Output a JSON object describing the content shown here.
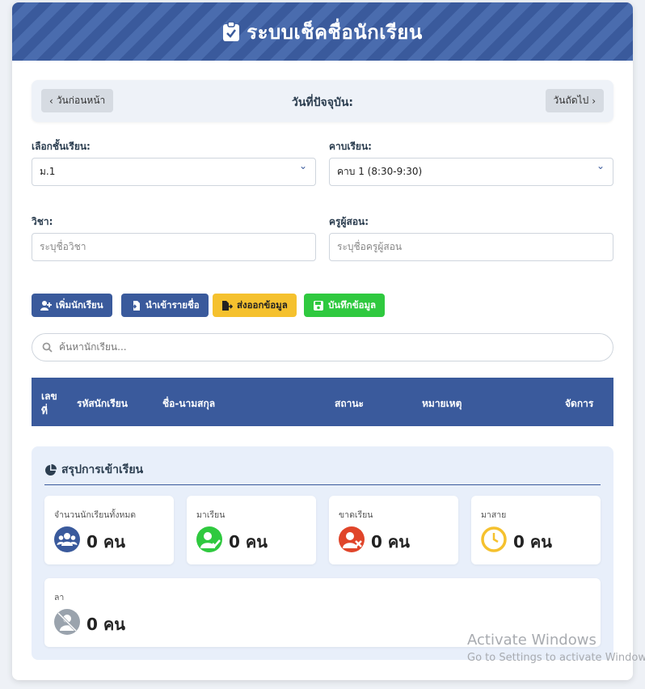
{
  "header": {
    "title": "ระบบเช็คชื่อนักเรียน",
    "icon": "clipboard-check-icon"
  },
  "datebar": {
    "prev_label": "วันก่อนหน้า",
    "current_label": "วันที่ปัจจุบัน:",
    "next_label": "วันถัดไป"
  },
  "form": {
    "class_label": "เลือกชั้นเรียน:",
    "class_value": "ม.1",
    "period_label": "คาบเรียน:",
    "period_value": "คาบ 1 (8:30-9:30)",
    "subject_label": "วิชา:",
    "subject_placeholder": "ระบุชื่อวิชา",
    "teacher_label": "ครูผู้สอน:",
    "teacher_placeholder": "ระบุชื่อครูผู้สอน"
  },
  "actions": {
    "add_student": "เพิ่มนักเรียน",
    "import_list": "นำเข้ารายชื่อ",
    "export_data": "ส่งออกข้อมูล",
    "save_data": "บันทึกข้อมูล"
  },
  "search": {
    "placeholder": "ค้นหานักเรียน..."
  },
  "table": {
    "columns": {
      "no_line1": "เลข",
      "no_line2": "ที่",
      "student_id": "รหัสนักเรียน",
      "full_name": "ชื่อ-นามสกุล",
      "status": "สถานะ",
      "note": "หมายเหตุ",
      "manage": "จัดการ"
    }
  },
  "summary": {
    "title": "สรุปการเข้าเรียน",
    "total": {
      "label": "จำนวนนักเรียนทั้งหมด",
      "value": "0 คน",
      "color": "#3a5a9c"
    },
    "present": {
      "label": "มาเรียน",
      "value": "0 คน",
      "color": "#2fc93f"
    },
    "absent": {
      "label": "ขาดเรียน",
      "value": "0 คน",
      "color": "#e0452a"
    },
    "late": {
      "label": "มาสาย",
      "value": "0 คน",
      "color": "#f5c12e"
    },
    "leave": {
      "label": "ลา",
      "value": "0 คน",
      "color": "#9aa3ad"
    }
  },
  "watermark": {
    "line1": "Activate Windows",
    "line2": "Go to Settings to activate Windows."
  }
}
